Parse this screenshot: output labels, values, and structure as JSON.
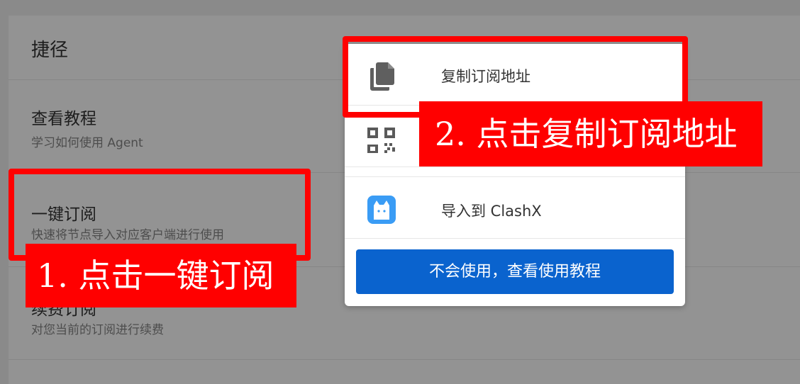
{
  "panel": {
    "title": "捷径"
  },
  "menu": {
    "items": [
      {
        "title": "查看教程",
        "desc": "学习如何使用 Agent"
      },
      {
        "title": "一键订阅",
        "desc": "快速将节点导入对应客户端进行使用"
      },
      {
        "title": "续费订阅",
        "desc": "对您当前的订阅进行续费"
      }
    ]
  },
  "popup": {
    "rows": [
      {
        "label": "复制订阅地址",
        "icon": "copy-icon"
      },
      {
        "label": "",
        "icon": "qr-code-icon"
      },
      {
        "label": "导入到 ClashX",
        "icon": "clashx-cat-icon"
      }
    ],
    "tutorial_button": "不会使用，查看使用教程"
  },
  "annotations": {
    "step1": "1. 点击一键订阅",
    "step2": "2. 点击复制订阅地址"
  },
  "colors": {
    "accent": "#0a63ce",
    "annotation_red": "#ff0000",
    "clashx_blue": "#3a9cf5"
  }
}
